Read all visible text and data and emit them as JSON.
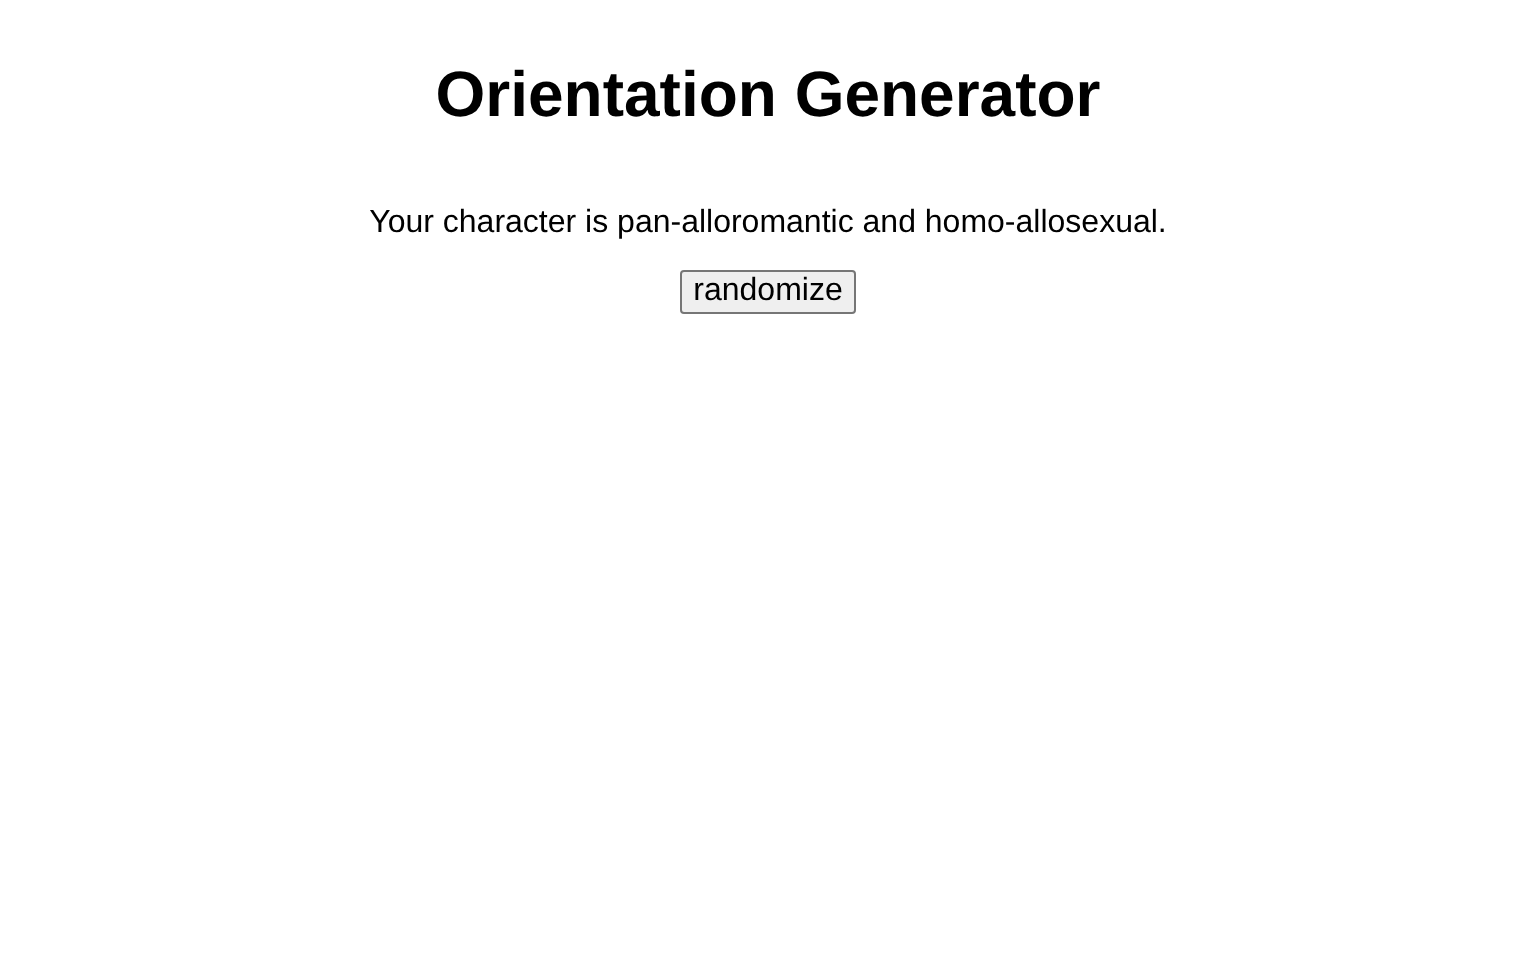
{
  "title": "Orientation Generator",
  "result": "Your character is pan-alloromantic and homo-allosexual.",
  "button": "randomize"
}
